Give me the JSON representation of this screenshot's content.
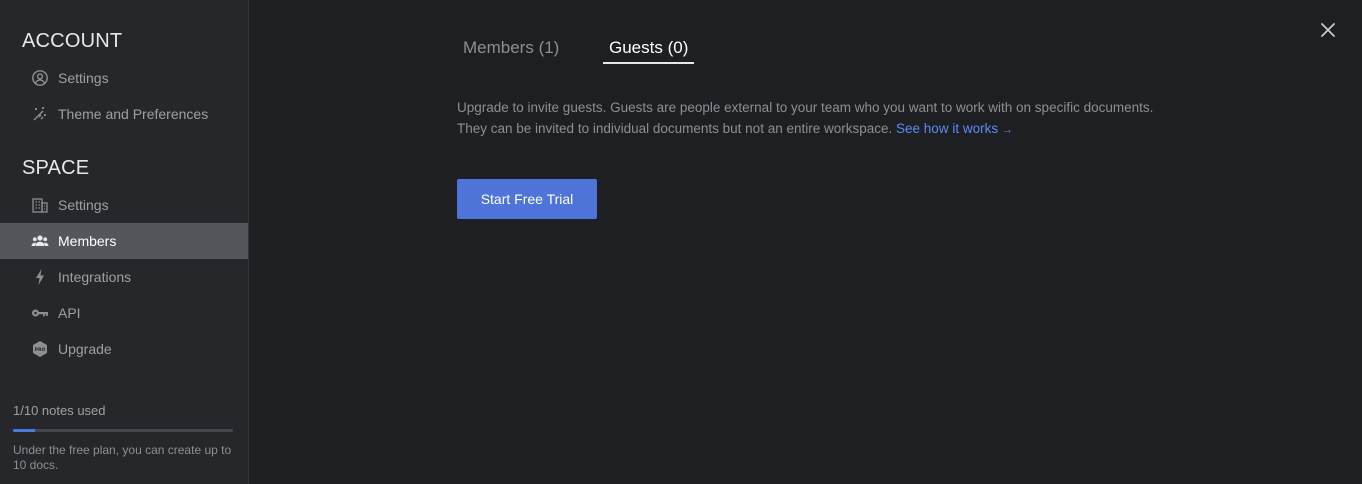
{
  "sidebar": {
    "account_title": "ACCOUNT",
    "account_items": [
      {
        "label": "Settings",
        "icon": "user-circle-icon"
      },
      {
        "label": "Theme and Preferences",
        "icon": "magic-wand-icon"
      }
    ],
    "space_title": "SPACE",
    "space_items": [
      {
        "label": "Settings",
        "icon": "building-icon"
      },
      {
        "label": "Members",
        "icon": "people-icon",
        "active": true
      },
      {
        "label": "Integrations",
        "icon": "lightning-icon"
      },
      {
        "label": "API",
        "icon": "key-icon"
      },
      {
        "label": "Upgrade",
        "icon": "pro-badge-icon"
      }
    ],
    "usage": {
      "label": "1/10 notes used",
      "progress": 0.1,
      "note": "Under the free plan, you can create up to 10 docs."
    }
  },
  "main": {
    "tabs": [
      {
        "label": "Members (1)",
        "active": false
      },
      {
        "label": "Guests (0)",
        "active": true
      }
    ],
    "description": "Upgrade to invite guests. Guests are people external to your team who you want to work with on specific documents. They can be invited to individual documents but not an entire workspace.",
    "link_label": "See how it works",
    "link_arrow": "→",
    "cta_label": "Start Free Trial"
  },
  "colors": {
    "accent": "#4e74d9",
    "link": "#5d8bf0",
    "background": "#1e1f23",
    "sidebar": "#26272b"
  },
  "close_icon": "close-icon"
}
